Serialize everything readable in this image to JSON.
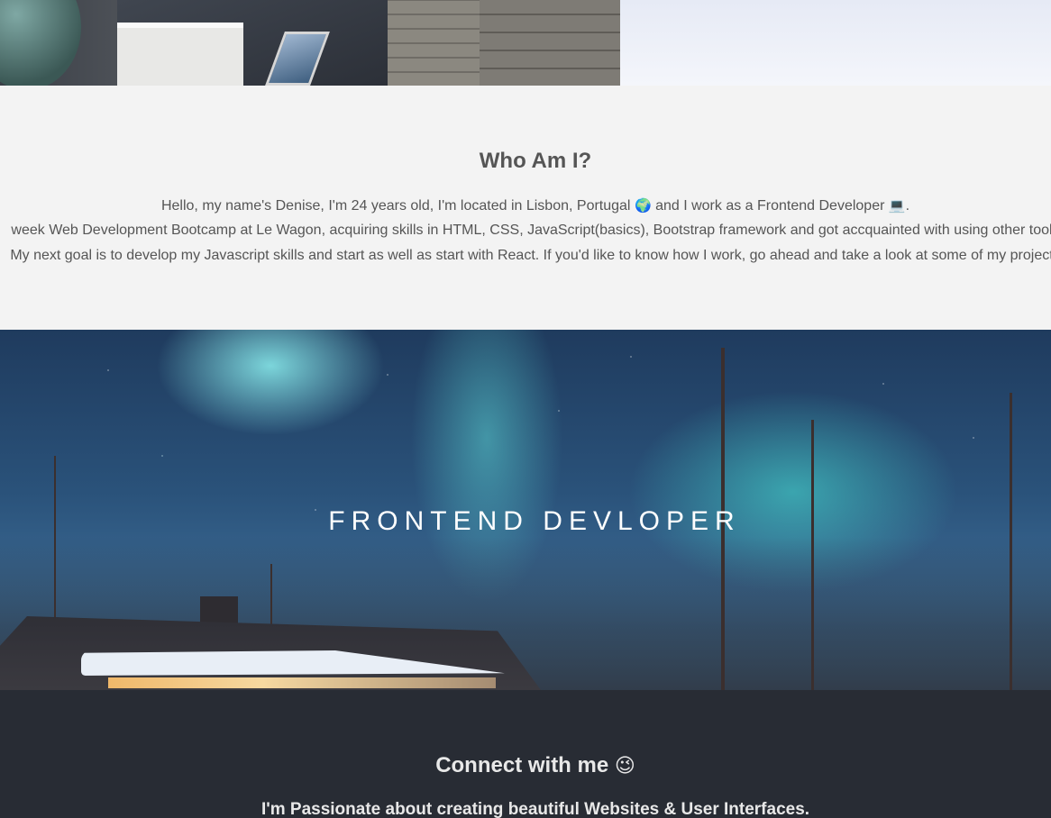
{
  "about": {
    "heading": "Who Am I?",
    "line1_before": "Hello, my name's Denise, I'm 24 years old, I'm located in Lisbon, Portugal ",
    "line1_globe": "🌍",
    "line1_middle": " and I work as a Frontend Developer ",
    "line1_laptop": "💻",
    "line1_end": ".",
    "line2": "week Web Development Bootcamp at Le Wagon, acquiring skills in HTML, CSS, JavaScript(basics), Bootstrap framework and got accquainted with using other tools",
    "line3": "My next goal is to develop my Javascript skills and start as well as start with React. If you'd like to know how I work, go ahead and take a look at some of my projects"
  },
  "banner": {
    "title": "FRONTEND DEVLOPER"
  },
  "footer": {
    "heading": "Connect with me ",
    "heading_emoji": "😉",
    "tagline": "I'm Passionate about creating beautiful Websites & User Interfaces."
  }
}
